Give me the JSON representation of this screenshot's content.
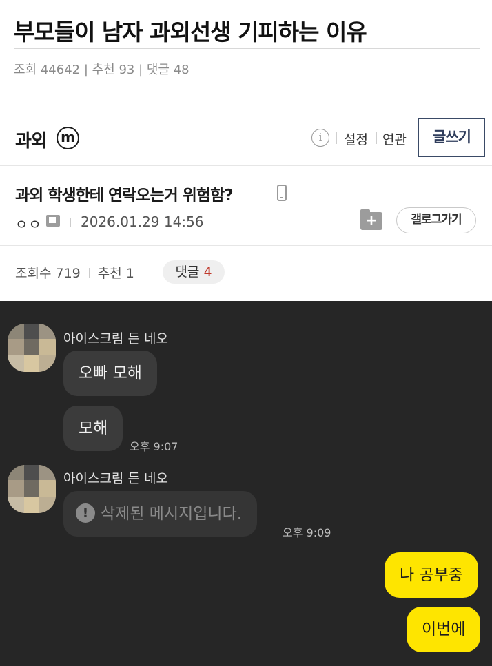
{
  "post": {
    "title": "부모들이 남자 과외선생 기피하는 이유",
    "stats": "조회 44642 | 추천 93 | 댓글 48"
  },
  "gallery": {
    "name": "과외",
    "minor_badge": "m",
    "info_glyph": "i",
    "links": {
      "settings": "설정",
      "related": "연관"
    },
    "write_button": "글쓰기"
  },
  "thread": {
    "title": "과외 학생한테 연락오는거 위험함?",
    "author": "ㅇㅇ",
    "date": "2026.01.29 14:56",
    "folder_glyph": "+",
    "gallery_go": "갤로그가기",
    "views": "조회수 719",
    "recommend": "추천 1",
    "comments_label": "댓글",
    "comments_count": "4"
  },
  "chat": {
    "sender_name": "아이스크림 든 네오",
    "messages": [
      {
        "text": "오빠 모해"
      },
      {
        "text": "모해",
        "time": "오후 9:07"
      },
      {
        "text": "삭제된 메시지입니다.",
        "time": "오후 9:09",
        "deleted_glyph": "!"
      },
      {
        "text": "나 공부중"
      },
      {
        "text": "이번에"
      }
    ]
  },
  "colors": {
    "chat_background": "#262626",
    "my_bubble": "#fee500",
    "their_bubble": "#3b3b3b",
    "comment_count": "#c0392b"
  },
  "icons": [
    "minor-gallery-icon",
    "info-icon",
    "phone-icon",
    "user-badge-icon",
    "folder-add-icon",
    "warning-icon",
    "avatar-icon"
  ]
}
